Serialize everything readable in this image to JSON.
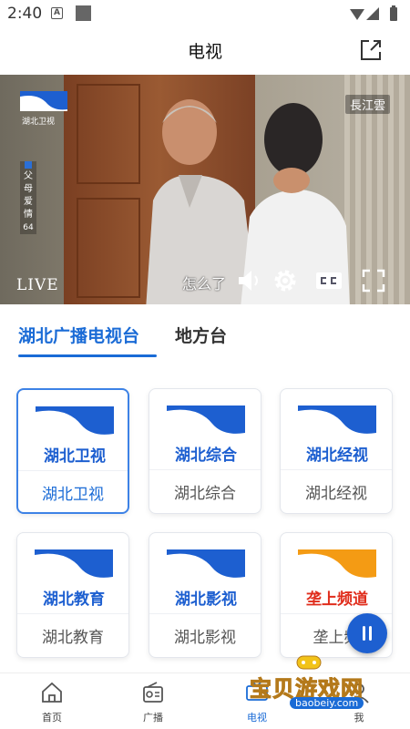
{
  "status_bar": {
    "time": "2:40",
    "notification_letter": "A"
  },
  "header": {
    "title": "电视"
  },
  "player": {
    "channel_logo_name": "湖北卫视",
    "program_badge_chars": [
      "父",
      "母",
      "爱",
      "情"
    ],
    "program_badge_num": "64",
    "watermark": "長江雲",
    "live_label": "LIVE",
    "subtitle": "怎么了"
  },
  "tabs": [
    {
      "label": "湖北广播电视台",
      "active": true
    },
    {
      "label": "地方台",
      "active": false
    }
  ],
  "channels": [
    {
      "label": "湖北卫视",
      "logo_text": "湖北卫视",
      "logo_color": "#1d5fd0",
      "selected": true
    },
    {
      "label": "湖北综合",
      "logo_text": "湖北综合",
      "logo_color": "#1d5fd0",
      "selected": false
    },
    {
      "label": "湖北经视",
      "logo_text": "湖北经视",
      "logo_color": "#1d5fd0",
      "selected": false
    },
    {
      "label": "湖北教育",
      "logo_text": "湖北教育",
      "logo_color": "#1d5fd0",
      "selected": false
    },
    {
      "label": "湖北影视",
      "logo_text": "湖北影视",
      "logo_color": "#1d5fd0",
      "selected": false
    },
    {
      "label": "垄上频",
      "logo_text": "垄上频道",
      "logo_color": "#e02d1c",
      "selected": false
    }
  ],
  "bottom_nav": [
    {
      "label": "首页",
      "icon": "home-icon",
      "active": false
    },
    {
      "label": "广播",
      "icon": "radio-icon",
      "active": false
    },
    {
      "label": "电视",
      "icon": "tv-icon",
      "active": true
    },
    {
      "label": "我",
      "icon": "profile-icon",
      "active": false
    }
  ],
  "overlay_watermark": {
    "text": "宝贝游戏网",
    "url": "baobeiy.com"
  },
  "colors": {
    "accent": "#1a6bd6",
    "logo_orange": "#f49b14"
  }
}
